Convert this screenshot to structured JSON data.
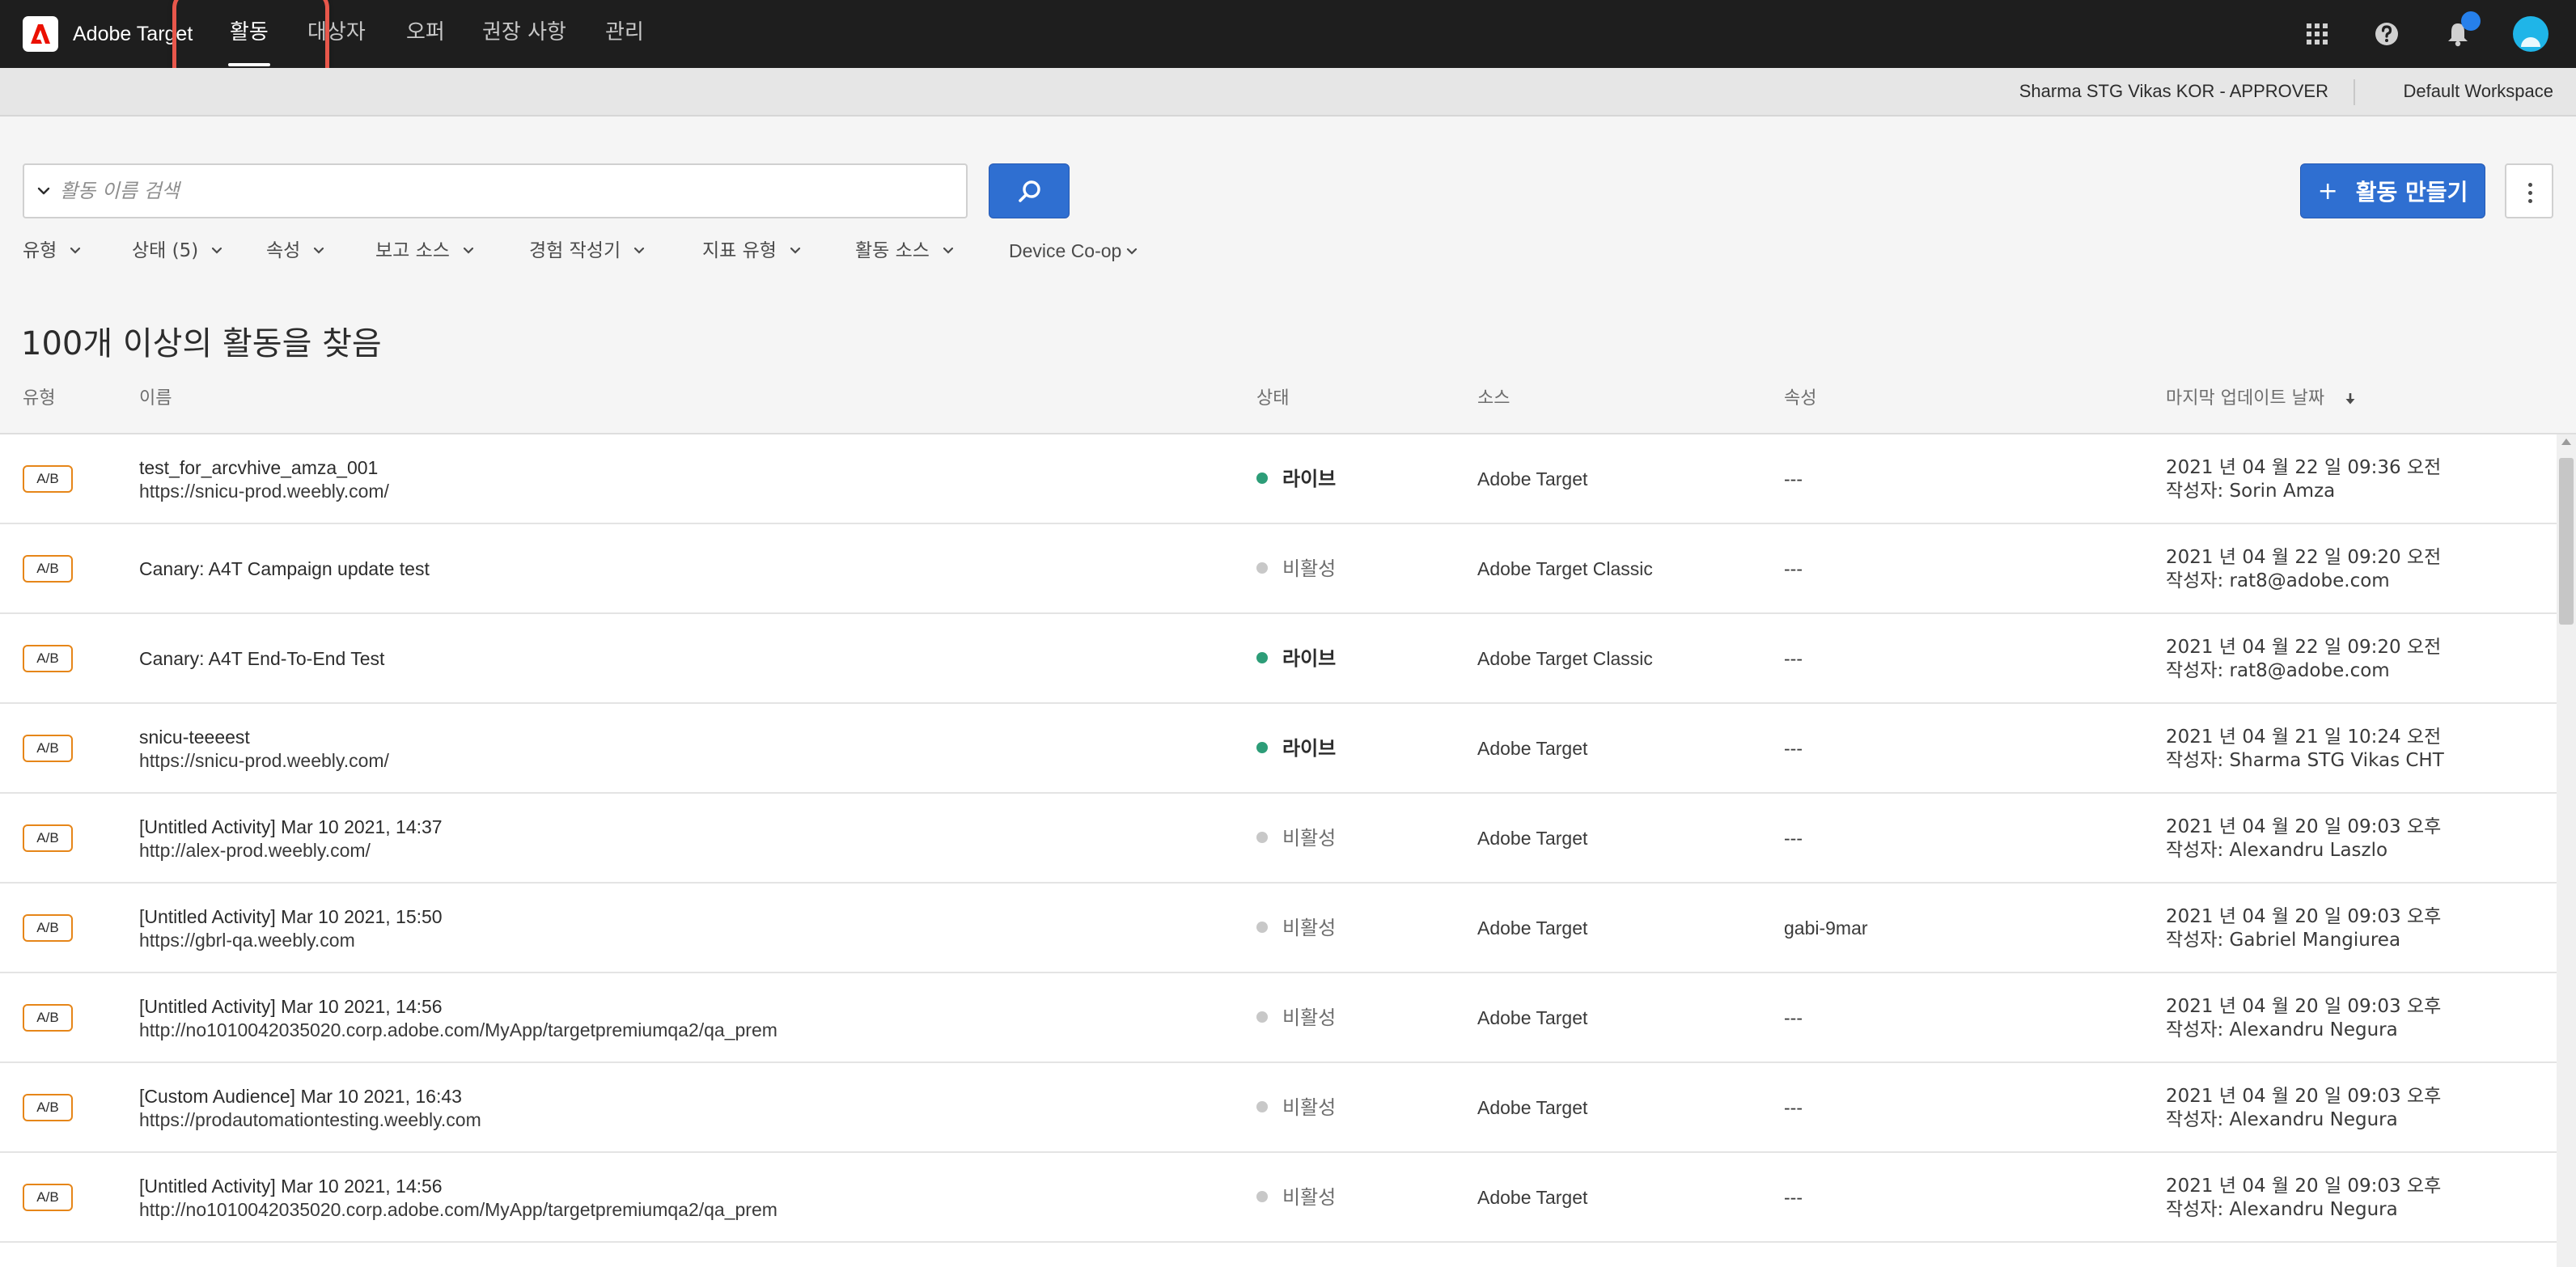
{
  "app": {
    "title": "Adobe Target"
  },
  "nav": {
    "tabs": [
      {
        "label": "활동",
        "active": true
      },
      {
        "label": "대상자",
        "active": false
      },
      {
        "label": "오퍼",
        "active": false
      },
      {
        "label": "권장 사항",
        "active": false
      },
      {
        "label": "관리",
        "active": false
      }
    ],
    "icons": [
      "apps-grid-icon",
      "help-icon",
      "notifications-bell-icon",
      "user-avatar-icon"
    ]
  },
  "subbar": {
    "user": "Sharma STG Vikas KOR - APPROVER",
    "workspace": "Default Workspace"
  },
  "search": {
    "placeholder": "활동 이름 검색"
  },
  "actions": {
    "create_label": "활동 만들기",
    "create_plus": "+"
  },
  "filters": [
    {
      "label": "유형"
    },
    {
      "label": "상태 (5)"
    },
    {
      "label": "속성"
    },
    {
      "label": "보고 소스"
    },
    {
      "label": "경험 작성기"
    },
    {
      "label": "지표 유형"
    },
    {
      "label": "활동 소스"
    },
    {
      "label": "Device Co-op"
    }
  ],
  "results": {
    "heading": "100개 이상의 활동을 찾음"
  },
  "table": {
    "headers": {
      "type": "유형",
      "name": "이름",
      "status": "상태",
      "source": "소스",
      "property": "속성",
      "updated": "마지막 업데이트 날짜"
    },
    "rows": [
      {
        "badge": "A/B",
        "name": "test_for_arcvhive_amza_001",
        "url": "https://snicu-prod.weebly.com/",
        "status": "라이브",
        "status_kind": "live",
        "source": "Adobe Target",
        "property": "---",
        "date": "2021 년 04 월 22 일 09:36 오전",
        "author": "작성자: Sorin Amza"
      },
      {
        "badge": "A/B",
        "name": "Canary: A4T Campaign update test",
        "url": "",
        "status": "비활성",
        "status_kind": "inactive",
        "source": "Adobe Target Classic",
        "property": "---",
        "date": "2021 년 04 월 22 일 09:20 오전",
        "author": "작성자: rat8@adobe.com"
      },
      {
        "badge": "A/B",
        "name": "Canary: A4T End-To-End Test",
        "url": "",
        "status": "라이브",
        "status_kind": "live",
        "source": "Adobe Target Classic",
        "property": "---",
        "date": "2021 년 04 월 22 일 09:20 오전",
        "author": "작성자: rat8@adobe.com"
      },
      {
        "badge": "A/B",
        "name": "snicu-teeeest",
        "url": "https://snicu-prod.weebly.com/",
        "status": "라이브",
        "status_kind": "live",
        "source": "Adobe Target",
        "property": "---",
        "date": "2021 년 04 월 21 일 10:24 오전",
        "author": "작성자: Sharma STG Vikas CHT"
      },
      {
        "badge": "A/B",
        "name": "[Untitled Activity] Mar 10 2021, 14:37",
        "url": "http://alex-prod.weebly.com/",
        "status": "비활성",
        "status_kind": "inactive",
        "source": "Adobe Target",
        "property": "---",
        "date": "2021 년 04 월 20 일 09:03 오후",
        "author": "작성자: Alexandru Laszlo"
      },
      {
        "badge": "A/B",
        "name": "[Untitled Activity] Mar 10 2021, 15:50",
        "url": "https://gbrl-qa.weebly.com",
        "status": "비활성",
        "status_kind": "inactive",
        "source": "Adobe Target",
        "property": "gabi-9mar",
        "date": "2021 년 04 월 20 일 09:03 오후",
        "author": "작성자: Gabriel Mangiurea"
      },
      {
        "badge": "A/B",
        "name": "[Untitled Activity] Mar 10 2021, 14:56",
        "url": "http://no1010042035020.corp.adobe.com/MyApp/targetpremiumqa2/qa_prem",
        "status": "비활성",
        "status_kind": "inactive",
        "source": "Adobe Target",
        "property": "---",
        "date": "2021 년 04 월 20 일 09:03 오후",
        "author": "작성자: Alexandru Negura"
      },
      {
        "badge": "A/B",
        "name": "[Custom Audience] Mar 10 2021, 16:43",
        "url": "https://prodautomationtesting.weebly.com",
        "status": "비활성",
        "status_kind": "inactive",
        "source": "Adobe Target",
        "property": "---",
        "date": "2021 년 04 월 20 일 09:03 오후",
        "author": "작성자: Alexandru Negura"
      },
      {
        "badge": "A/B",
        "name": "[Untitled Activity] Mar 10 2021, 14:56",
        "url": "http://no1010042035020.corp.adobe.com/MyApp/targetpremiumqa2/qa_prem",
        "status": "비활성",
        "status_kind": "inactive",
        "source": "Adobe Target",
        "property": "---",
        "date": "2021 년 04 월 20 일 09:03 오후",
        "author": "작성자: Alexandru Negura"
      }
    ]
  },
  "colors": {
    "nav_bg": "#1e1e1e",
    "accent_blue": "#2f6fd1",
    "badge_border": "#e68619",
    "status_live": "#2d9d78",
    "status_inactive": "#c8c8c8",
    "highlight_ring": "#e8574b",
    "avatar": "#1fb5e8"
  }
}
